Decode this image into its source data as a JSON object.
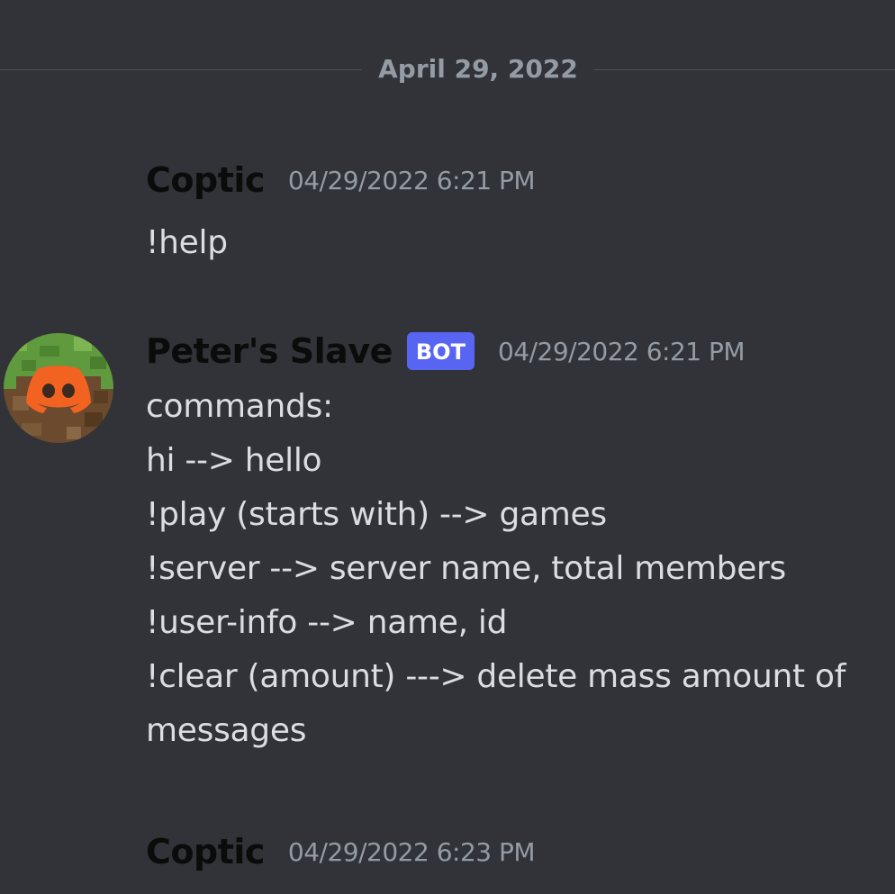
{
  "date_divider": "April 29, 2022",
  "messages": [
    {
      "author": "Coptic",
      "timestamp": "04/29/2022 6:21 PM",
      "lines": [
        "!help"
      ]
    },
    {
      "author": "Peter's Slave",
      "badge": "BOT",
      "timestamp": "04/29/2022 6:21 PM",
      "avatar_icon": "discord-logo-on-grass-block",
      "lines": [
        "commands:",
        "hi --> hello",
        "!play (starts with) --> games",
        "!server --> server name, total members",
        "!user-info --> name, id",
        "!clear (amount) ---> delete mass amount of",
        "messages"
      ]
    },
    {
      "author": "Coptic",
      "timestamp": "04/29/2022 6:23 PM",
      "lines": []
    }
  ],
  "colors": {
    "background": "#313338",
    "author_name": "#0b0b0b",
    "timestamp": "#949ba4",
    "message_text": "#dbdee1",
    "bot_badge": "#5865f2",
    "avatar_logo": "#f26322",
    "avatar_grass": "#5f9a3e"
  }
}
